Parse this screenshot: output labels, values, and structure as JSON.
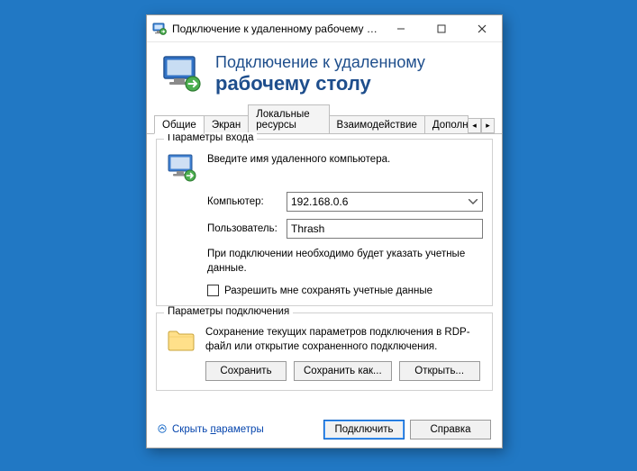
{
  "window": {
    "title": "Подключение к удаленному рабочему с..."
  },
  "header": {
    "line1": "Подключение к удаленному",
    "line2": "рабочему столу"
  },
  "tabs": {
    "items": [
      {
        "label": "Общие"
      },
      {
        "label": "Экран"
      },
      {
        "label": "Локальные ресурсы"
      },
      {
        "label": "Взаимодействие"
      },
      {
        "label": "Дополни"
      }
    ]
  },
  "login_group": {
    "legend": "Параметры входа",
    "instruction": "Введите имя удаленного компьютера.",
    "computer_label": "Компьютер:",
    "computer_value": "192.168.0.6",
    "user_label": "Пользователь:",
    "user_value": "Thrash",
    "hint": "При подключении необходимо будет указать учетные данные.",
    "checkbox_label": "Разрешить мне сохранять учетные данные"
  },
  "conn_group": {
    "legend": "Параметры подключения",
    "text": "Сохранение текущих параметров подключения в RDP-файл или открытие сохраненного подключения.",
    "save": "Сохранить",
    "save_as": "Сохранить как...",
    "open": "Открыть..."
  },
  "footer": {
    "hide_params_prefix": "Скрыть ",
    "hide_params_underline": "п",
    "hide_params_suffix": "араметры",
    "connect": "Подключить",
    "help": "Справка"
  }
}
